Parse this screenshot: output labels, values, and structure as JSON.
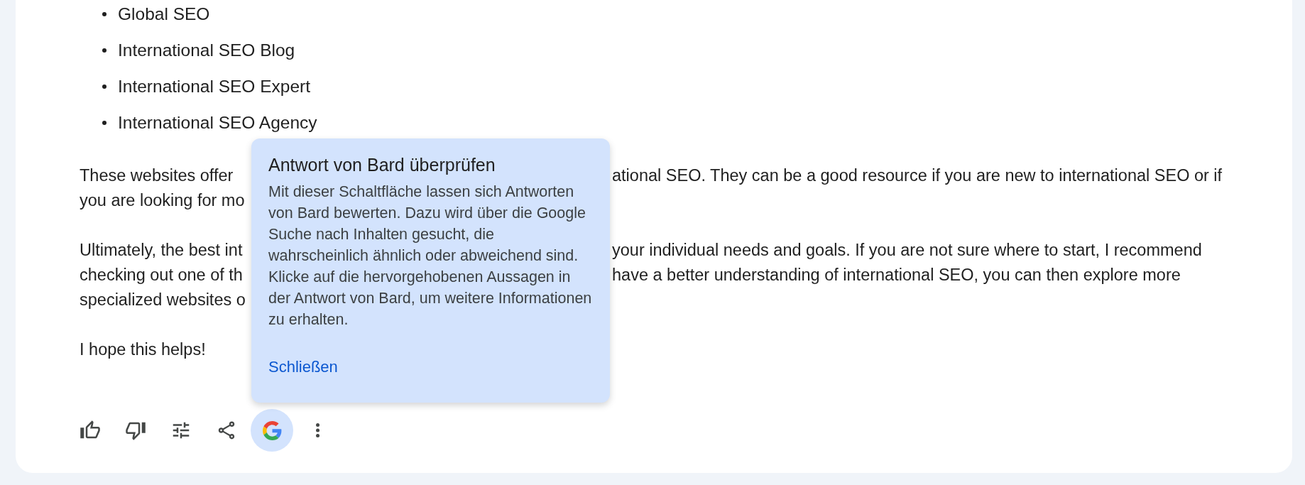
{
  "response": {
    "list_items": [
      "Global SEO",
      "International SEO Blog",
      "International SEO Expert",
      "International SEO Agency"
    ],
    "paragraphs": [
      {
        "lines": [
          {
            "before_popover": "These websites offer",
            "after_popover": "ational SEO. They can be a good resource if you are new to international SEO or if"
          },
          {
            "before_popover": "you are looking for mo"
          }
        ]
      },
      {
        "lines": [
          {
            "before_popover": "Ultimately, the best int",
            "after_popover": "your individual needs and goals. If you are not sure where to start, I recommend"
          },
          {
            "before_popover": "checking out one of th",
            "after_popover": "have a better understanding of international SEO, you can then explore more"
          },
          {
            "before_popover": "specialized websites o"
          }
        ]
      },
      {
        "lines": [
          {
            "before_popover": "I hope this helps!"
          }
        ]
      }
    ]
  },
  "popover": {
    "title": "Antwort von Bard überprüfen",
    "body": "Mit dieser Schaltfläche lassen sich Antworten\nvon Bard bewerten. Dazu wird über die Google\nSuche nach Inhalten gesucht, die\nwahrscheinlich ähnlich oder abweichend sind.\nKlicke auf die hervorgehobenen Aussagen in\nder Antwort von Bard, um weitere Informationen\nzu erhalten.",
    "link": "Schließen"
  },
  "actions": [
    {
      "kind": "thumb_up",
      "selected": false
    },
    {
      "kind": "thumb_down",
      "selected": false
    },
    {
      "kind": "tune",
      "selected": false
    },
    {
      "kind": "share",
      "selected": false
    },
    {
      "kind": "google",
      "selected": true
    },
    {
      "kind": "more",
      "selected": false
    }
  ]
}
